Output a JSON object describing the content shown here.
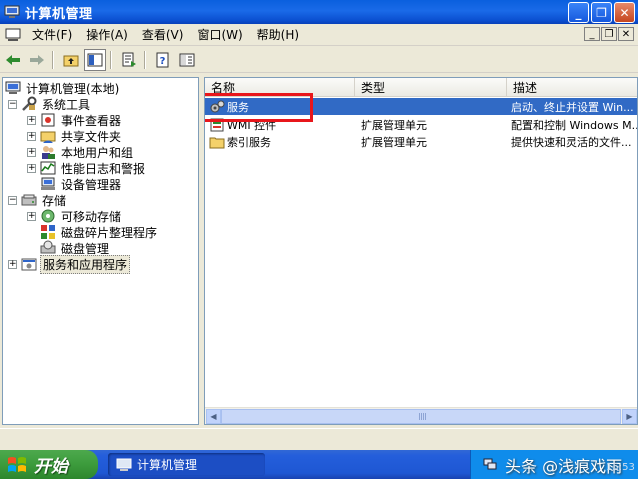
{
  "window": {
    "title": "计算机管理"
  },
  "menu": [
    "文件(F)",
    "操作(A)",
    "查看(V)",
    "窗口(W)",
    "帮助(H)"
  ],
  "tree": {
    "root": "计算机管理(本地)",
    "system_tools": "系统工具",
    "event_viewer": "事件查看器",
    "shared_folders": "共享文件夹",
    "local_users": "本地用户和组",
    "perf_logs": "性能日志和警报",
    "device_manager": "设备管理器",
    "storage": "存储",
    "removable_storage": "可移动存储",
    "defrag": "磁盘碎片整理程序",
    "disk_management": "磁盘管理",
    "services_apps": "服务和应用程序"
  },
  "list": {
    "columns": [
      "名称",
      "类型",
      "描述"
    ],
    "rows": [
      {
        "name": "服务",
        "type": "",
        "desc": "启动、终止并设置 Win..."
      },
      {
        "name": "WMI 控件",
        "type": "扩展管理单元",
        "desc": "配置和控制 Windows M..."
      },
      {
        "name": "索引服务",
        "type": "扩展管理单元",
        "desc": "提供快速和灵活的文件..."
      }
    ]
  },
  "taskbar": {
    "start_label": "开始",
    "task_label": "计算机管理",
    "watermark": "头条 @浅痕戏雨",
    "clock": "15:53"
  }
}
